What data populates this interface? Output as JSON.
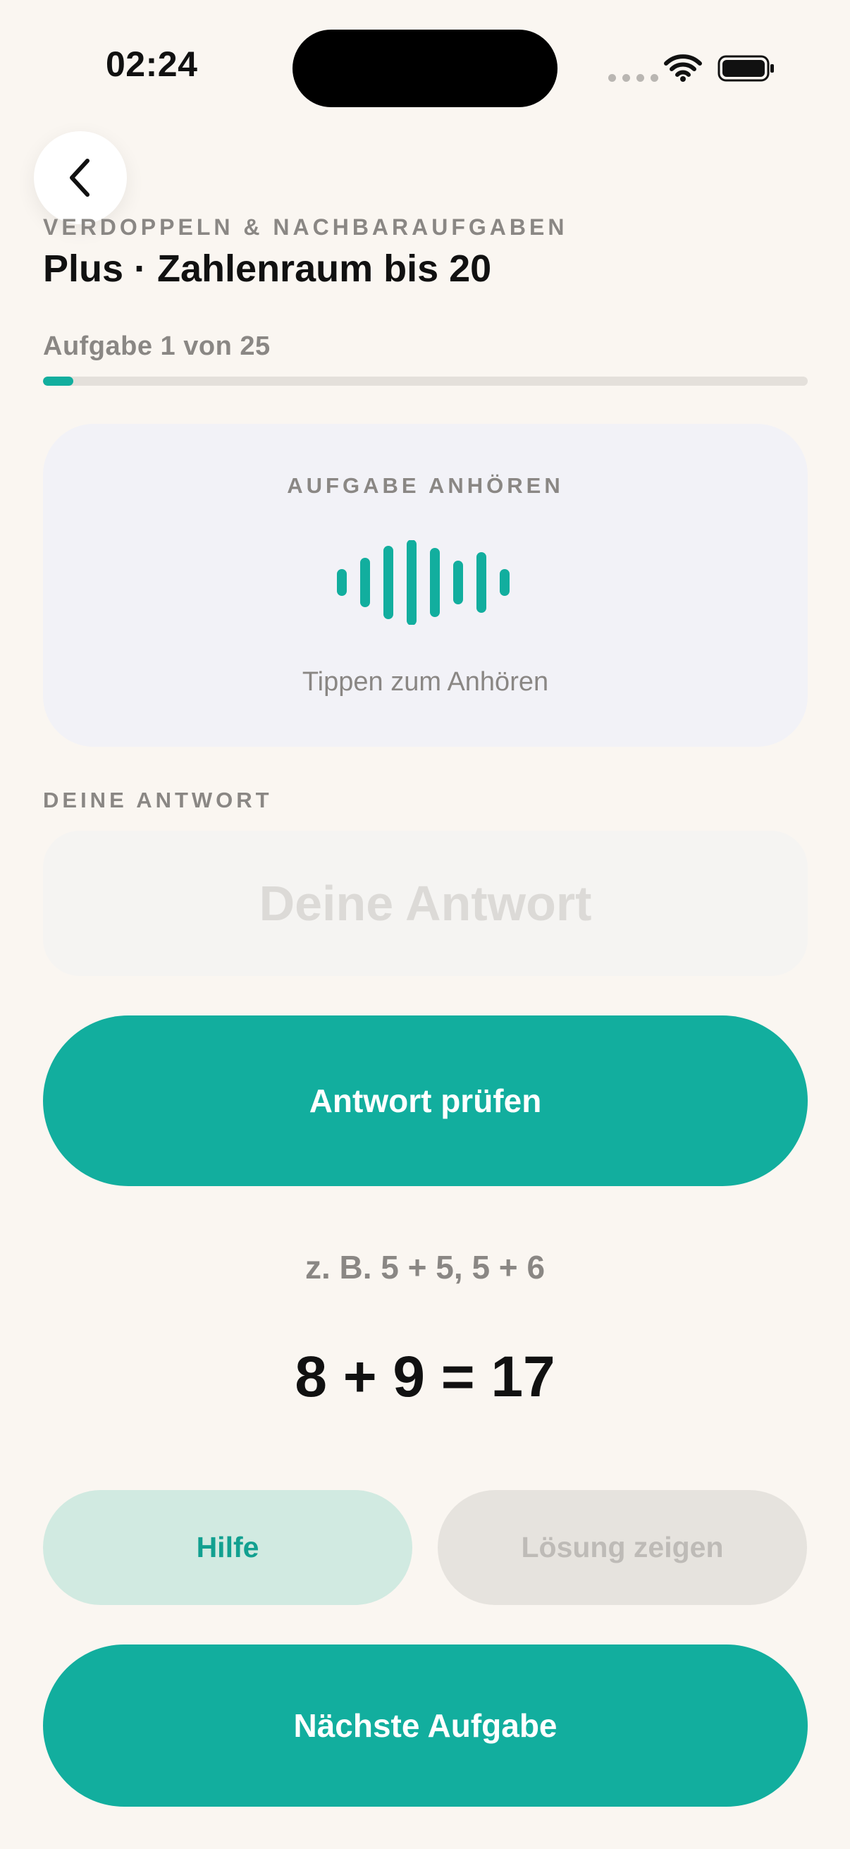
{
  "status_bar": {
    "time": "02:24"
  },
  "header": {
    "back_icon": "chevron-left-icon",
    "category": "VERDOPPELN & NACHBARAUFGABEN",
    "title": "Plus · Zahlenraum bis 20"
  },
  "progress": {
    "label": "Aufgabe 1 von 25",
    "current": 1,
    "total": 25
  },
  "audio_card": {
    "heading": "AUFGABE ANHÖREN",
    "icon": "waveform-icon",
    "hint": "Tippen zum Anhören"
  },
  "answer": {
    "label": "DEINE ANTWORT",
    "placeholder": "Deine Antwort",
    "value": ""
  },
  "actions": {
    "check_label": "Antwort prüfen",
    "help_label": "Hilfe",
    "solution_label": "Lösung zeigen",
    "next_label": "Nächste Aufgabe"
  },
  "example": {
    "hint": "z. B. 5 + 5, 5 + 6",
    "equation": "8 + 9 = 17"
  },
  "colors": {
    "accent": "#12AE9E",
    "background": "#FAF6F1",
    "card": "#F2F2F7",
    "help_bg": "#D1EAE1",
    "disabled_bg": "#E6E3DE",
    "secondary_text": "#8A8784"
  }
}
